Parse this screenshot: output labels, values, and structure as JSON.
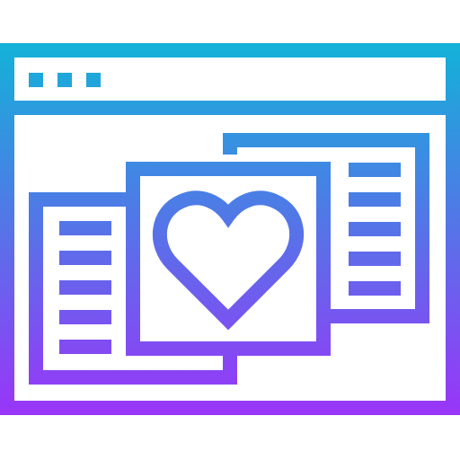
{
  "icon": {
    "name": "browser-window-favorite-documents-icon",
    "gradient": {
      "top_color": "#12B2D8",
      "bottom_color": "#9A35F8"
    },
    "window": {
      "title_bar_dots": 3
    },
    "documents": [
      {
        "name": "left-document",
        "text_lines": 5
      },
      {
        "name": "center-document",
        "symbol": "heart"
      },
      {
        "name": "right-document",
        "text_lines": 5
      }
    ]
  }
}
